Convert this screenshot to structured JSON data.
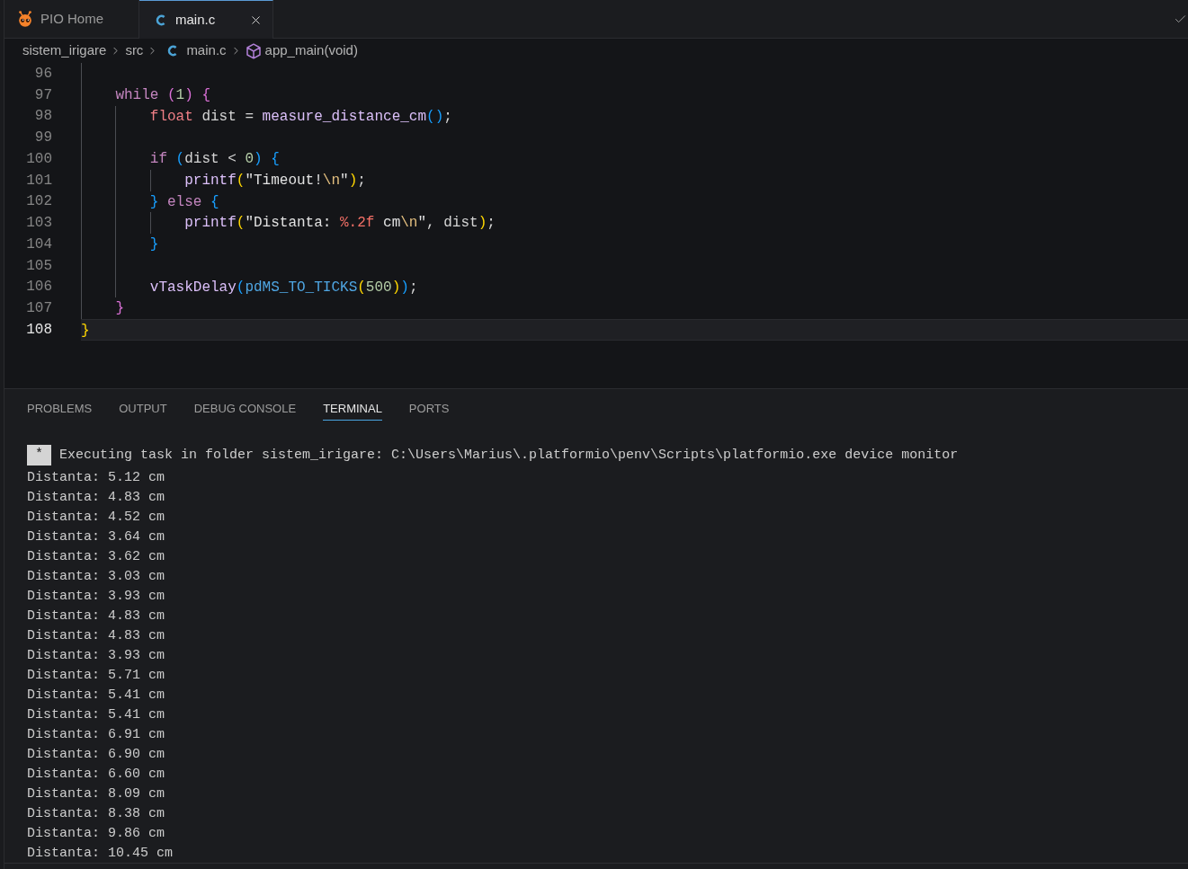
{
  "tabs": [
    {
      "label": "PIO Home",
      "kind": "home",
      "selected": false
    },
    {
      "label": "main.c",
      "kind": "file",
      "selected": true
    }
  ],
  "breadcrumb": [
    {
      "label": "sistem_irigare",
      "kind": "folder"
    },
    {
      "label": "src",
      "kind": "folder"
    },
    {
      "label": "main.c",
      "kind": "file"
    },
    {
      "label": "app_main(void)",
      "kind": "function"
    }
  ],
  "code": {
    "lines": [
      {
        "kind": "block",
        "children": [
          {
            "kind": "line",
            "number": "96",
            "current": false
          },
          {
            "kind": "line",
            "number": "97",
            "current": false,
            "tokens": [
              {
                "text": "while ",
                "kind": "keyword"
              },
              {
                "text": "(",
                "kind": "bracket",
                "color": "#da70d6"
              },
              {
                "text": "1",
                "kind": "number"
              },
              {
                "text": ") {",
                "kind": "bracket",
                "color": "#da70d6"
              }
            ],
            "children": [
              {
                "kind": "line",
                "number": "98",
                "current": false,
                "tokens": [
                  {
                    "text": "float ",
                    "kind": "type"
                  },
                  {
                    "text": "dist = ",
                    "kind": "plain"
                  },
                  {
                    "text": "measure_distance_cm",
                    "kind": "function"
                  },
                  {
                    "text": "()",
                    "kind": "bracket",
                    "color": "#179fff"
                  },
                  {
                    "text": ";",
                    "kind": "plain"
                  }
                ]
              },
              {
                "kind": "line",
                "number": "99",
                "current": false
              },
              {
                "kind": "line",
                "number": "100",
                "current": false,
                "tokens": [
                  {
                    "text": "if ",
                    "kind": "keyword"
                  },
                  {
                    "text": "(",
                    "kind": "bracket",
                    "color": "#179fff"
                  },
                  {
                    "text": "dist < ",
                    "kind": "plain"
                  },
                  {
                    "text": "0",
                    "kind": "number"
                  },
                  {
                    "text": ") {",
                    "kind": "bracket",
                    "color": "#179fff"
                  }
                ],
                "children": [
                  {
                    "kind": "line",
                    "number": "101",
                    "current": false,
                    "tokens": [
                      {
                        "text": "printf",
                        "kind": "function"
                      },
                      {
                        "text": "(",
                        "kind": "bracket",
                        "color": "#ffd700"
                      },
                      {
                        "text": "\"Timeout!",
                        "kind": "string"
                      },
                      {
                        "text": "\\n",
                        "kind": "escape"
                      },
                      {
                        "text": "\"",
                        "kind": "string"
                      },
                      {
                        "text": ")",
                        "kind": "bracket",
                        "color": "#ffd700"
                      },
                      {
                        "text": ";",
                        "kind": "plain"
                      }
                    ]
                  }
                ]
              },
              {
                "kind": "line",
                "number": "102",
                "current": false,
                "tokens": [
                  {
                    "text": "} ",
                    "kind": "bracket",
                    "color": "#179fff"
                  },
                  {
                    "text": "else ",
                    "kind": "keyword"
                  },
                  {
                    "text": "{",
                    "kind": "bracket",
                    "color": "#179fff"
                  }
                ],
                "children": [
                  {
                    "kind": "line",
                    "number": "103",
                    "current": false,
                    "tokens": [
                      {
                        "text": "printf",
                        "kind": "function"
                      },
                      {
                        "text": "(",
                        "kind": "bracket",
                        "color": "#ffd700"
                      },
                      {
                        "text": "\"Distanta: ",
                        "kind": "string"
                      },
                      {
                        "text": "%.2f",
                        "kind": "format"
                      },
                      {
                        "text": " cm",
                        "kind": "string"
                      },
                      {
                        "text": "\\n",
                        "kind": "escape"
                      },
                      {
                        "text": "\"",
                        "kind": "string"
                      },
                      {
                        "text": ", dist",
                        "kind": "plain"
                      },
                      {
                        "text": ")",
                        "kind": "bracket",
                        "color": "#ffd700"
                      },
                      {
                        "text": ";",
                        "kind": "plain"
                      }
                    ]
                  }
                ]
              },
              {
                "kind": "line",
                "number": "104",
                "current": false,
                "tokens": [
                  {
                    "text": "}",
                    "kind": "bracket",
                    "color": "#179fff"
                  }
                ]
              },
              {
                "kind": "line",
                "number": "105",
                "current": false
              },
              {
                "kind": "line",
                "number": "106",
                "current": false,
                "tokens": [
                  {
                    "text": "vTaskDelay",
                    "kind": "function"
                  },
                  {
                    "text": "(",
                    "kind": "bracket",
                    "color": "#179fff"
                  },
                  {
                    "text": "pdMS_TO_TICKS",
                    "kind": "macro"
                  },
                  {
                    "text": "(",
                    "kind": "bracket",
                    "color": "#ffd700"
                  },
                  {
                    "text": "500",
                    "kind": "number"
                  },
                  {
                    "text": ")",
                    "kind": "bracket",
                    "color": "#ffd700"
                  },
                  {
                    "text": ")",
                    "kind": "bracket",
                    "color": "#179fff"
                  },
                  {
                    "text": ";",
                    "kind": "plain"
                  }
                ]
              }
            ]
          },
          {
            "kind": "line",
            "number": "107",
            "current": false,
            "tokens": [
              {
                "text": "}",
                "kind": "bracket",
                "color": "#da70d6"
              }
            ]
          }
        ]
      },
      {
        "kind": "line",
        "number": "108",
        "current": true,
        "tokens": [
          {
            "text": "}",
            "kind": "bracket",
            "color": "#ffd700"
          }
        ]
      }
    ]
  },
  "panel": {
    "tabs": [
      {
        "label": "PROBLEMS",
        "selected": false
      },
      {
        "label": "OUTPUT",
        "selected": false
      },
      {
        "label": "DEBUG CONSOLE",
        "selected": false
      },
      {
        "label": "TERMINAL",
        "selected": true
      },
      {
        "label": "PORTS",
        "selected": false
      }
    ]
  },
  "terminal": {
    "task_marker": "*",
    "task_line": "Executing task in folder sistem_irigare: C:\\Users\\Marius\\.platformio\\penv\\Scripts\\platformio.exe device monitor",
    "lines": [
      "Distanta: 5.12 cm",
      "Distanta: 4.83 cm",
      "Distanta: 4.52 cm",
      "Distanta: 3.64 cm",
      "Distanta: 3.62 cm",
      "Distanta: 3.03 cm",
      "Distanta: 3.93 cm",
      "Distanta: 4.83 cm",
      "Distanta: 4.83 cm",
      "Distanta: 3.93 cm",
      "Distanta: 5.71 cm",
      "Distanta: 5.41 cm",
      "Distanta: 5.41 cm",
      "Distanta: 6.91 cm",
      "Distanta: 6.90 cm",
      "Distanta: 6.60 cm",
      "Distanta: 8.09 cm",
      "Distanta: 8.38 cm",
      "Distanta: 9.86 cm",
      "Distanta: 10.45 cm"
    ]
  }
}
